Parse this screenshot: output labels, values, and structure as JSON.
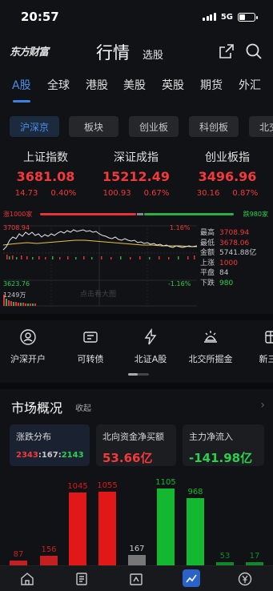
{
  "status": {
    "time": "20:57",
    "network": "5G"
  },
  "header": {
    "logo": "东方财富",
    "title": "行情",
    "stock_pick": "选股"
  },
  "market_tabs": [
    "A股",
    "全球",
    "港股",
    "美股",
    "英股",
    "期货",
    "外汇"
  ],
  "sub_tabs": [
    "沪深京",
    "板块",
    "创业板",
    "科创板",
    "北交所"
  ],
  "indices": [
    {
      "name": "上证指数",
      "value": "3681.08",
      "change": "14.73",
      "pct": "0.40%"
    },
    {
      "name": "深证成指",
      "value": "15212.49",
      "change": "100.93",
      "pct": "0.67%"
    },
    {
      "name": "创业板指",
      "value": "3496.96",
      "change": "30.16",
      "pct": "0.87%"
    }
  ],
  "breadth": {
    "up_label": "涨1000家",
    "down_label": "跌980家"
  },
  "chart": {
    "y_high": "3708.94",
    "y_low": "3623.76",
    "pct_high": "1.16%",
    "pct_low": "-1.16%",
    "volume": "1249万",
    "hint": "点击看大图"
  },
  "stats": [
    {
      "label": "最高",
      "value": "3708.94",
      "color": "red"
    },
    {
      "label": "最低",
      "value": "3678.06",
      "color": "red"
    },
    {
      "label": "金额",
      "value": "5741.88亿",
      "color": "gray"
    },
    {
      "label": "上涨",
      "value": "1000",
      "color": "red"
    },
    {
      "label": "平盘",
      "value": "84",
      "color": "gray"
    },
    {
      "label": "下跌",
      "value": "980",
      "color": "green"
    }
  ],
  "quick_links": [
    "沪深开户",
    "可转债",
    "北证A股",
    "北交所掘金",
    "新三板"
  ],
  "overview": {
    "title": "市场概况",
    "collapse": "收起",
    "cards": [
      {
        "title": "涨跌分布",
        "split": [
          "2343",
          "167",
          "2143"
        ]
      },
      {
        "title": "北向资金净买额",
        "value": "53.66亿"
      },
      {
        "title": "主力净流入",
        "value": "-141.98亿"
      }
    ]
  },
  "distribution": [
    {
      "label": "87",
      "value": 87,
      "color": "#c42020"
    },
    {
      "label": "156",
      "value": 156,
      "color": "#c42020"
    },
    {
      "label": "1045",
      "value": 1045,
      "color": "#e01818"
    },
    {
      "label": "1055",
      "value": 1055,
      "color": "#e01818"
    },
    {
      "label": "167",
      "value": 167,
      "color": "#777777"
    },
    {
      "label": "1105",
      "value": 1105,
      "color": "#14b830"
    },
    {
      "label": "968",
      "value": 968,
      "color": "#14b830"
    },
    {
      "label": "53",
      "value": 53,
      "color": "#108a28"
    },
    {
      "label": "17",
      "value": 17,
      "color": "#108a28"
    }
  ],
  "colors": {
    "up": "#f23a3a",
    "down": "#2bd14e",
    "accent": "#4a8fe8",
    "background": "#111215"
  }
}
